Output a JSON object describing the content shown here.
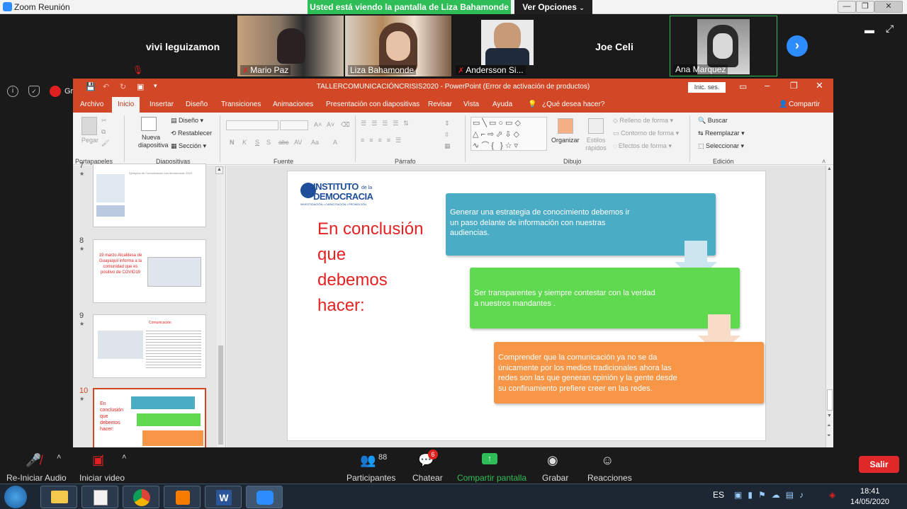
{
  "zoom": {
    "window_title": "Zoom Reunión",
    "share_banner": "Usted está viendo la pantalla de Liza Bahamonde",
    "view_options": "Ver Opciones",
    "participants": [
      {
        "name": "vivi leguizamon",
        "video": false
      },
      {
        "name": "Mario Paz",
        "video": true,
        "muted": true
      },
      {
        "name": "Liza Bahamonde",
        "video": true
      },
      {
        "name": "Andersson Si...",
        "video": true,
        "muted": true
      },
      {
        "name": "Joe Celi",
        "video": false
      },
      {
        "name": "Ana Marquez",
        "video": true
      }
    ],
    "recording_label": "Grabando",
    "toolbar": {
      "audio": "Re-Iniciar Audio",
      "video": "Iniciar video",
      "participants_label": "Participantes",
      "participants_count": "88",
      "chat": "Chatear",
      "chat_badge": "6",
      "share": "Compartir pantalla",
      "record": "Grabar",
      "reactions": "Reacciones",
      "leave": "Salir"
    },
    "colors": {
      "accent": "#2d8cff",
      "share_green": "#2fbd57",
      "leave_red": "#e02828"
    }
  },
  "powerpoint": {
    "title": "TALLERCOMUNICACIÓNCRISIS2020  -  PowerPoint (Error de activación de productos)",
    "signin": "Inic. ses.",
    "tabs": [
      "Archivo",
      "Inicio",
      "Insertar",
      "Diseño",
      "Transiciones",
      "Animaciones",
      "Presentación con diapositivas",
      "Revisar",
      "Vista",
      "Ayuda"
    ],
    "tell_me": "¿Qué desea hacer?",
    "share": "Compartir",
    "ribbon": {
      "paste": "Pegar",
      "new_slide": "Nueva diapositiva",
      "layout": "Diseño",
      "reset": "Restablecer",
      "section": "Sección",
      "arrange": "Organizar",
      "quick_styles": "Estilos rápidos",
      "shape_fill": "Relleno de forma",
      "shape_outline": "Contorno de forma",
      "shape_effects": "Efectos de forma",
      "find": "Buscar",
      "replace": "Reemplazar",
      "select": "Seleccionar",
      "groups": [
        "Portapapeles",
        "Diapositivas",
        "Fuente",
        "Párrafo",
        "Dibujo",
        "Edición"
      ]
    },
    "thumbnails": [
      {
        "num": "7",
        "text": "Ejemplos de Comunicación con democracia: 2020"
      },
      {
        "num": "8",
        "text": "19 marzo Alcaldesa de Guayaquil informa a la comunidad que es positivo de COVID19"
      },
      {
        "num": "9",
        "text": "Comunicación"
      },
      {
        "num": "10",
        "text": "En conclusión que debemos hacer:",
        "selected": true
      }
    ],
    "slide": {
      "logo_line1": "INSTITUTO",
      "logo_de_la": "de la",
      "logo_line2": "DEMOCRACIA",
      "logo_sub": "INVESTIGACIÓN • CAPACITACIÓN • PROMOCIÓN",
      "heading_lines": [
        "En conclusión",
        "que",
        "debemos",
        "hacer:"
      ],
      "boxes": [
        {
          "lines": [
            "Generar una estrategia de conocimiento debemos ir",
            "un paso delante de información con nuestras",
            "audiencias."
          ],
          "color": "#4bacc6"
        },
        {
          "lines": [
            "Ser transparentes y siempre contestar con la verdad",
            "a nuestros mandantes ."
          ],
          "color": "#5fd94f"
        },
        {
          "lines": [
            "Comprender que la comunicación ya no se da",
            "únicamente por los medios tradicionales ahora las",
            "redes son las que generan opinión y la gente desde",
            "su confinamiento prefiere creer en las redes."
          ],
          "color": "#f79646"
        }
      ]
    },
    "colors": {
      "brand": "#d24726",
      "heading_red": "#e42221"
    }
  },
  "taskbar": {
    "language": "ES",
    "time": "18:41",
    "date": "14/05/2020"
  }
}
